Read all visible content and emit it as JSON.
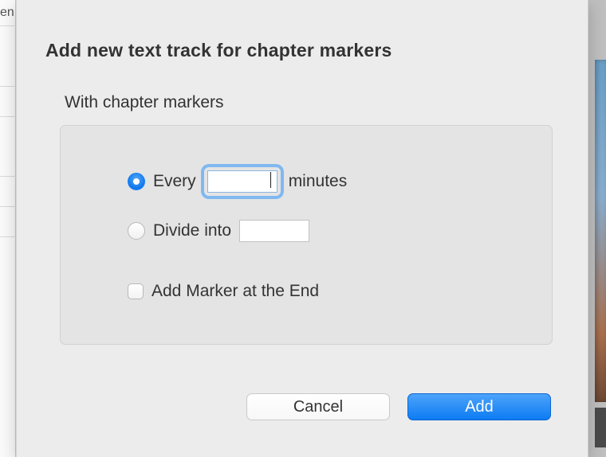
{
  "left_fragment": "en",
  "dialog": {
    "title": "Add new text track for chapter markers",
    "section_label": "With chapter markers",
    "options": {
      "every": {
        "label_before": "Every",
        "value": "",
        "label_after": "minutes",
        "selected": true
      },
      "divide": {
        "label": "Divide into",
        "value": "",
        "selected": false
      },
      "end_marker": {
        "label": "Add Marker at the End",
        "checked": false
      }
    },
    "buttons": {
      "cancel": "Cancel",
      "add": "Add"
    }
  }
}
